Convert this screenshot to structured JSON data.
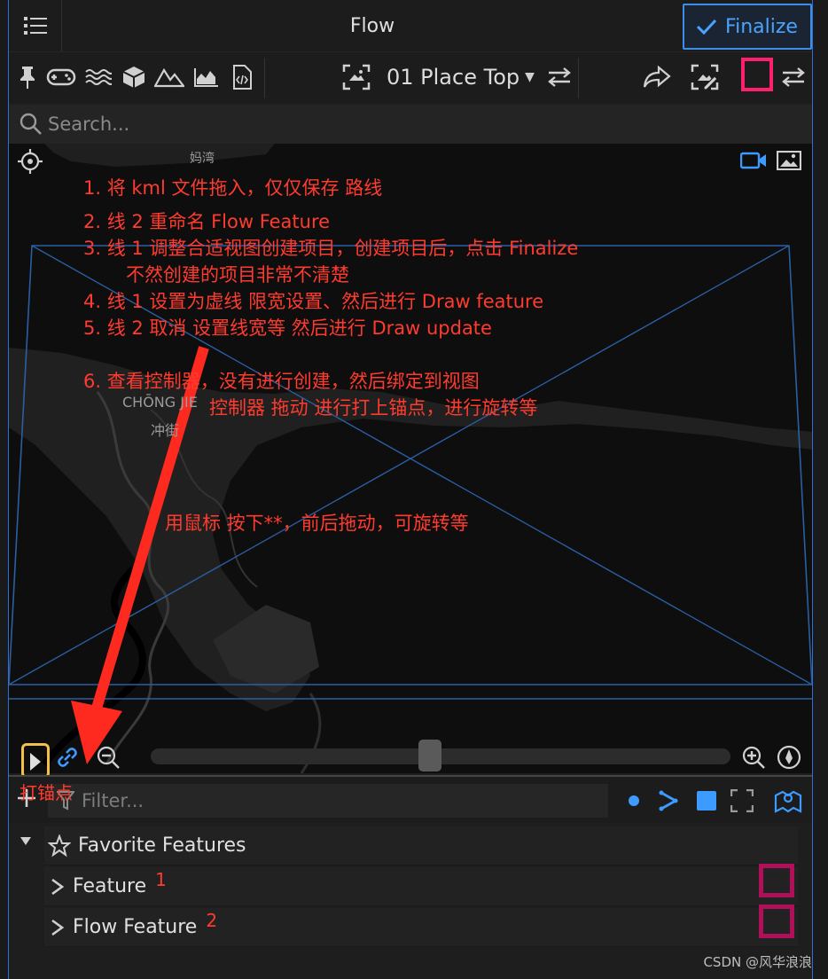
{
  "header": {
    "title": "Flow",
    "finalize_label": "Finalize"
  },
  "toolbar": {
    "place_name": "01 Place Top",
    "icons": [
      "pin-icon",
      "gamepad-icon",
      "water-icon",
      "cube-icon",
      "mountain-icon",
      "area-chart-icon",
      "code-file-icon",
      "place-camera-icon",
      "swap-icon",
      "share-icon",
      "edit-image-icon",
      "swap-icon"
    ]
  },
  "search": {
    "placeholder": "Search..."
  },
  "map": {
    "label_top": "妈湾",
    "label_district_en": "CHŌNG JIE",
    "label_district_cn": "冲街"
  },
  "annotations": {
    "step1": "1. 将 kml 文件拖入，仅仅保存 路线",
    "step2": "2. 线 2 重命名 Flow Feature",
    "step3": "3. 线 1 调整合适视图创建项目，创建项目后，点击 Finalize",
    "step3b": "不然创建的项目非常不清楚",
    "step4": "4. 线 1 设置为虚线 限宽设置、然后进行 Draw   feature",
    "step5": "5. 线 2 取消     设置线宽等    然后进行 Draw update",
    "step6": "6. 查看控制器，没有进行创建，然后绑定到视图",
    "step6b": "控制器 拖动 进行打上锚点，进行旋转等",
    "mouse_hint": "用鼠标 按下**，前后拖动，可旋转等",
    "anchor_label": "打锚点"
  },
  "filter": {
    "placeholder": "Filter..."
  },
  "features": {
    "group_label": "Favorite Features",
    "items": [
      {
        "label": "Feature",
        "note": "1"
      },
      {
        "label": "Flow Feature",
        "note": "2"
      }
    ]
  },
  "watermark": "CSDN @风华浪浪",
  "colors": {
    "accent": "#3d8ee8",
    "annotation": "#ff3b2f",
    "highlight_pink": "#ff1f6e",
    "anchor_yellow": "#f5c04a"
  }
}
